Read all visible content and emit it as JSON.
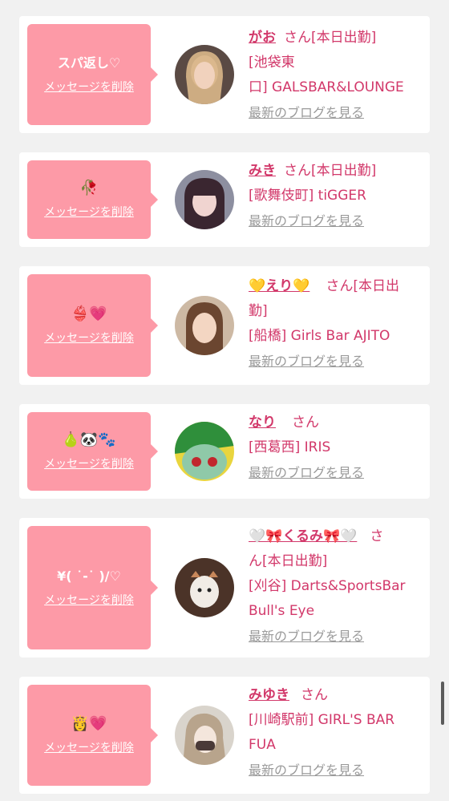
{
  "delete_label": "メッセージを削除",
  "san": "さん",
  "blog_link": "最新のブログを見る",
  "cards": [
    {
      "message": "スパ返し♡",
      "name": "がお",
      "status": "[本日出勤]",
      "shop_line1": "[池袋東",
      "shop_line2": "口] GALSBAR&LOUNGE"
    },
    {
      "message": "🥀",
      "name": "みき",
      "status": "[本日出勤]",
      "shop_line1": "[歌舞伎町] tiGGER"
    },
    {
      "message": "👙💗",
      "name": "💛えり💛",
      "status": "[本日出",
      "status_wrap": "勤]",
      "shop_line1": "[船橋] Girls Bar AJITO"
    },
    {
      "message": "🍐🐼🐾",
      "name": "なり",
      "shop_line1": "[西葛西] IRIS"
    },
    {
      "message": "¥( ˙-˙ )/♡",
      "name": "🤍🎀くるみ🎀🤍",
      "san_head": "さ",
      "san_tail": "ん",
      "status": "[本日出勤]",
      "shop_line1": "[刈谷] Darts&SportsBar",
      "shop_line2": "Bull's Eye"
    },
    {
      "message": "👸💗",
      "name": "みゆき",
      "shop_line1": "[川崎駅前] GIRL'S BAR",
      "shop_line2": "FUA"
    }
  ],
  "colors": {
    "accent_pink": "#fd9aa7",
    "name_pink": "#d2386a",
    "blog_gray": "#9a9a9a"
  }
}
